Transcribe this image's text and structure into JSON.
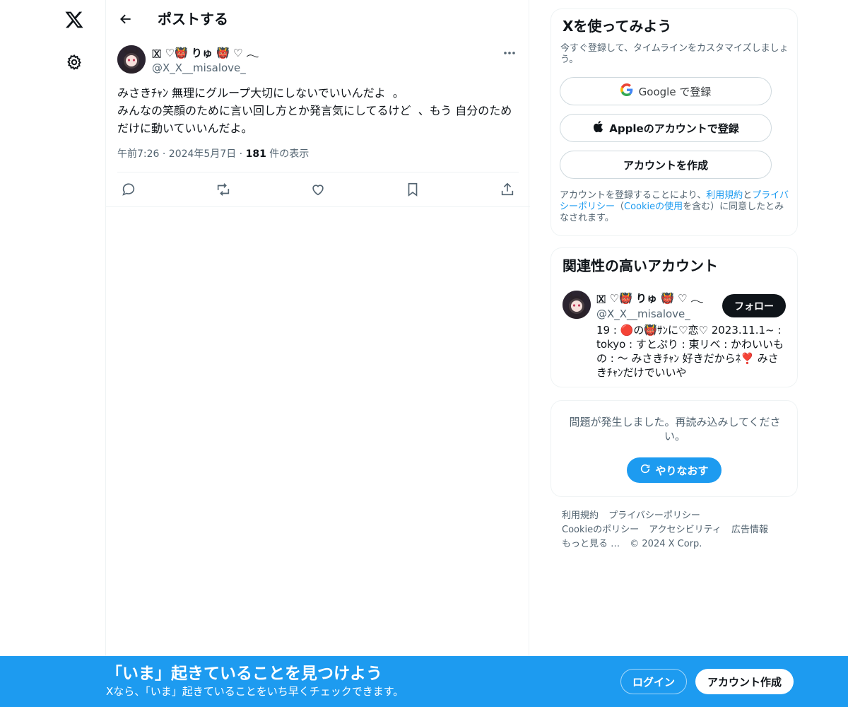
{
  "nav": {
    "logo_icon": "x-logo-icon",
    "settings_icon": "gear-icon"
  },
  "header": {
    "title": "ポストする"
  },
  "tweet": {
    "author_name": "🇽 ♡👹 りゅ 👹 ♡ 𓂃",
    "author_handle": "@X_X__misalove_",
    "text": "みさきﾁｬﾝ 無理にグループ大切にしないでいいんだよ  。\nみんなの笑顔のために言い回し方とか発言気にしてるけど  、もう 自分のためだけに動いていいんだよ。",
    "time": "午前7:26 · 2024年5月7日 · ",
    "views_count": "181",
    "views_label": " 件の表示"
  },
  "signup_card": {
    "title": "Xを使ってみよう",
    "subtitle": "今すぐ登録して、タイムラインをカスタマイズしましょう。",
    "google_label": "Google で登録",
    "apple_label": "Appleのアカウントで登録",
    "create_label": "アカウントを作成",
    "legal_prefix": "アカウントを登録することにより、",
    "legal_terms": "利用規約",
    "legal_and": "と",
    "legal_privacy": "プライバシーポリシー",
    "legal_paren_open": "（",
    "legal_cookie": "Cookieの使用",
    "legal_suffix": "を含む）に同意したとみなされます。"
  },
  "related": {
    "title": "関連性の高いアカウント",
    "name": "🇽 ♡👹 りゅ 👹 ♡ 𓂃",
    "handle": "@X_X__misalove_",
    "follow_label": "フォロー",
    "bio": "19 : 🔴の👹ｻﾝに♡恋♡ 2023.11.1~ : tokyo : すとぷり : 東リベ : かわいいもの : 〜 みさきﾁｬﾝ 好きだからﾈ❣️ みさきﾁｬﾝだけでいいや"
  },
  "error_card": {
    "message": "問題が発生しました。再読み込みしてください。",
    "retry_label": "やりなおす"
  },
  "footer": {
    "links": [
      "利用規約",
      "プライバシーポリシー",
      "Cookieのポリシー",
      "アクセシビリティ",
      "広告情報",
      "もっと見る …",
      "© 2024 X Corp."
    ]
  },
  "bottom_bar": {
    "title": "「いま」起きていることを見つけよう",
    "subtitle": "Xなら、「いま」起きていることをいち早くチェックできます。",
    "login_label": "ログイン",
    "signup_label": "アカウント作成"
  },
  "colors": {
    "accent": "#1d9bf0",
    "text": "#0f1419",
    "secondary": "#536471"
  }
}
